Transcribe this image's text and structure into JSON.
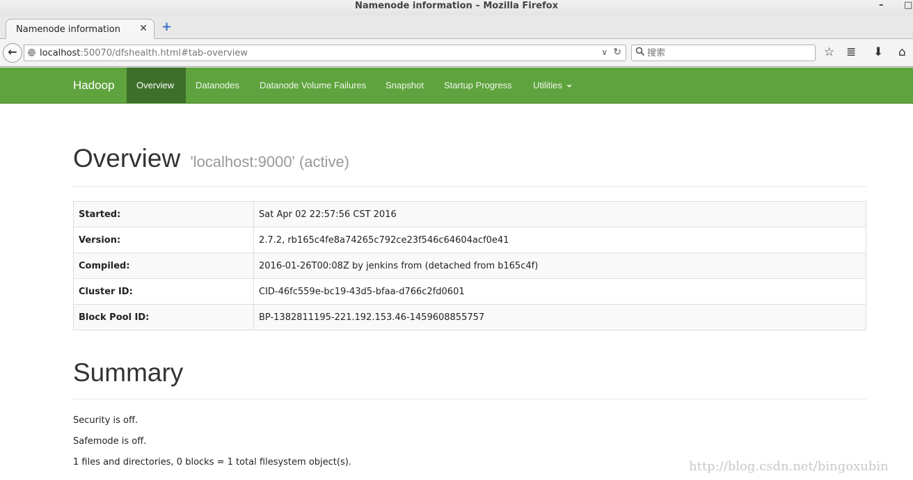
{
  "window": {
    "title": "Namenode information – Mozilla Firefox",
    "minimize_glyph": "–",
    "maximize_glyph": "□"
  },
  "tabs": [
    {
      "label": "Namenode information",
      "close_glyph": "✕",
      "active": true
    }
  ],
  "newtab_glyph": "+",
  "toolbar": {
    "back_glyph": "←",
    "url_host": "localhost",
    "url_rest": ":50070/dfshealth.html#tab-overview",
    "dropdown_glyph": "∨",
    "reload_glyph": "↻",
    "search_placeholder": "搜索",
    "search_glyph": "⌕",
    "bookmark_glyph": "☆",
    "reader_glyph": "≣",
    "download_glyph": "⬇",
    "home_glyph": "⌂"
  },
  "hadoop_nav": {
    "brand": "Hadoop",
    "items": [
      {
        "label": "Overview",
        "active": true
      },
      {
        "label": "Datanodes"
      },
      {
        "label": "Datanode Volume Failures"
      },
      {
        "label": "Snapshot"
      },
      {
        "label": "Startup Progress"
      },
      {
        "label": "Utilities",
        "has_caret": true
      }
    ]
  },
  "overview": {
    "heading": "Overview",
    "subtitle": "'localhost:9000' (active)",
    "rows": [
      {
        "key": "Started:",
        "value": "Sat Apr 02 22:57:56 CST 2016"
      },
      {
        "key": "Version:",
        "value": "2.7.2, rb165c4fe8a74265c792ce23f546c64604acf0e41"
      },
      {
        "key": "Compiled:",
        "value": "2016-01-26T00:08Z by jenkins from (detached from b165c4f)"
      },
      {
        "key": "Cluster ID:",
        "value": "CID-46fc559e-bc19-43d5-bfaa-d766c2fd0601"
      },
      {
        "key": "Block Pool ID:",
        "value": "BP-1382811195-221.192.153.46-1459608855757"
      }
    ]
  },
  "summary": {
    "heading": "Summary",
    "lines": [
      "Security is off.",
      "Safemode is off.",
      "1 files and directories, 0 blocks = 1 total filesystem object(s)."
    ]
  },
  "watermark": "http://blog.csdn.net/bingoxubin",
  "colors": {
    "hadoop_green": "#5fa33e",
    "active_tab": "#3d6f2a"
  }
}
